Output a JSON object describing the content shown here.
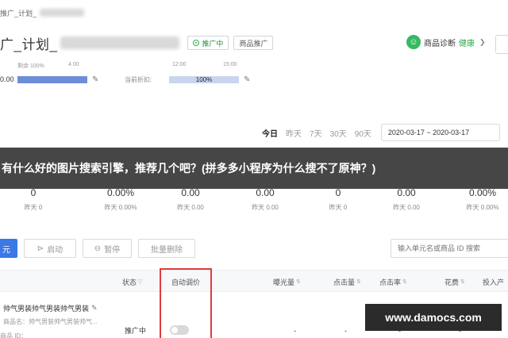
{
  "breadcrumb": {
    "text": "推广_计划_"
  },
  "plan": {
    "title": "广_计划_",
    "status_badge": "推广中",
    "type_badge": "商品推广"
  },
  "diagnosis": {
    "label": "商品诊断",
    "health": "健康",
    "chevron": "❯"
  },
  "budget_bar": {
    "tick_left": "剩余 100%",
    "tick_right": "4.00",
    "row_value": "0.00",
    "fill_percent": 100
  },
  "discount_bar": {
    "tick_left": "12:00",
    "tick_right": "15:00",
    "label": "当前折扣:",
    "value_text": "100%",
    "fill_percent": 100
  },
  "date_filter": {
    "options": [
      "今日",
      "昨天",
      "7天",
      "30天",
      "90天"
    ],
    "active_index": 0,
    "range": "2020-03-17 ~ 2020-03-17"
  },
  "watermark_text": "有什么好的图片搜索引擎，推荐几个吧？(拼多多小程序为什么搜不了原神？)",
  "metrics": [
    {
      "value": "0",
      "yesterday": "昨天 0"
    },
    {
      "value": "0.00%",
      "yesterday": "昨天 0.00%"
    },
    {
      "value": "0.00",
      "yesterday": "昨天 0.00"
    },
    {
      "value": "0.00",
      "yesterday": "昨天 0.00"
    },
    {
      "value": "0",
      "yesterday": "昨天 0"
    },
    {
      "value": "0.00",
      "yesterday": "昨天 0.00"
    },
    {
      "value": "0.00%",
      "yesterday": "昨天 0.00%"
    }
  ],
  "toolbar": {
    "primary_label": "元",
    "start_label": "启动",
    "pause_label": "暂停",
    "batch_delete_label": "批量删除",
    "search_placeholder": "输入单元名或商品 ID 搜索"
  },
  "table": {
    "headers": {
      "status": "状态",
      "auto_bid": "自动调价",
      "impressions": "曝光量",
      "clicks": "点击量",
      "ctr": "点击率",
      "spend": "花费",
      "roi": "投入产"
    },
    "row": {
      "name": "帅气男装帅气男装帅气男装",
      "sub": "商品名：帅气男装帅气男装帅气...",
      "id_label": "商品 ID：",
      "status": "推广中",
      "impressions": "-",
      "clicks": "-",
      "ctr": "-",
      "spend": "-",
      "roi": "-"
    }
  },
  "site_tag": "www.damocs.com",
  "colors": {
    "primary": "#3a78e6",
    "success": "#2fae46",
    "bar_fill": "#6e8dd8",
    "bar_track": "#c9d5ef",
    "highlight": "#e23b3b"
  }
}
